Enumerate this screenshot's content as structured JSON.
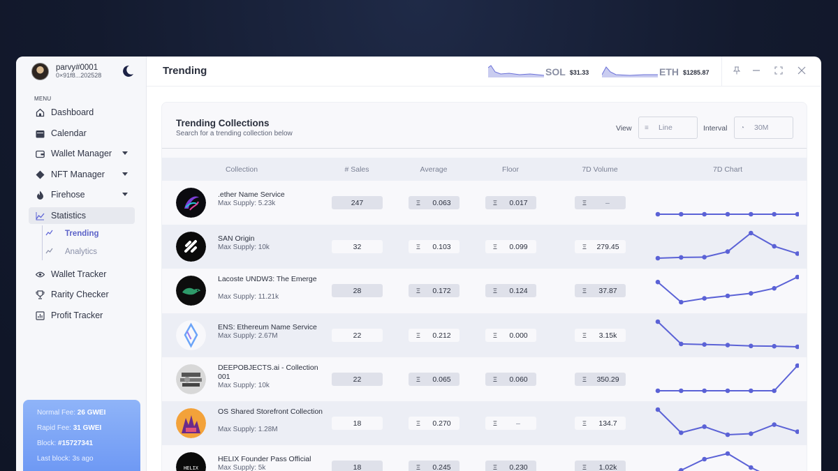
{
  "profile": {
    "name": "parvy#0001",
    "address": "0×91f8...202528"
  },
  "sidebar": {
    "menu_label": "MENU",
    "items": [
      {
        "label": "Dashboard",
        "icon": "home-icon"
      },
      {
        "label": "Calendar",
        "icon": "calendar-icon"
      },
      {
        "label": "Wallet Manager",
        "icon": "wallet-icon"
      },
      {
        "label": "NFT Manager",
        "icon": "diamond-icon"
      },
      {
        "label": "Firehose",
        "icon": "flame-icon"
      },
      {
        "label": "Statistics",
        "icon": "chart-icon"
      },
      {
        "label": "Wallet Tracker",
        "icon": "eye-icon"
      },
      {
        "label": "Rarity Checker",
        "icon": "trophy-icon"
      },
      {
        "label": "Profit Tracker",
        "icon": "report-icon"
      }
    ],
    "sub_items": [
      {
        "label": "Trending"
      },
      {
        "label": "Analytics"
      }
    ]
  },
  "fees": {
    "normal_label": "Normal Fee:",
    "normal_value": "26 GWEI",
    "rapid_label": "Rapid Fee:",
    "rapid_value": "31 GWEI",
    "block_label": "Block:",
    "block_value": "#15727341",
    "last_block": "Last block: 3s ago"
  },
  "header": {
    "title": "Trending",
    "tickers": [
      {
        "symbol": "SOL",
        "price": "$31.33"
      },
      {
        "symbol": "ETH",
        "price": "$1285.87"
      }
    ]
  },
  "panel": {
    "title": "Trending Collections",
    "subtitle": "Search for a trending collection below",
    "view_label": "View",
    "view_value": "Line",
    "interval_label": "Interval",
    "interval_value": "30M"
  },
  "table": {
    "columns": [
      "Collection",
      "# Sales",
      "Average",
      "Floor",
      "7D Volume",
      "7D Chart"
    ],
    "rows": [
      {
        "name": ".ether Name Service",
        "supply": "Max Supply: 5.23k",
        "sales": "247",
        "average": "0.063",
        "floor": "0.017",
        "volume": "–",
        "chart": [
          1,
          1,
          1,
          1,
          1,
          1,
          1
        ]
      },
      {
        "name": "SAN Origin",
        "supply": "Max Supply: 10k",
        "sales": "32",
        "average": "0.103",
        "floor": "0.099",
        "volume": "279.45",
        "chart": [
          0.6,
          0.9,
          1.0,
          3.2,
          10.5,
          5.3,
          2.4
        ]
      },
      {
        "name": "Lacoste UNDW3: The Emerge",
        "supply": "Max Supply: 11.21k",
        "sales": "28",
        "average": "0.172",
        "floor": "0.124",
        "volume": "37.87",
        "chart": [
          9.5,
          1.5,
          3.0,
          4.0,
          5.0,
          7.0,
          11.5
        ]
      },
      {
        "name": "ENS: Ethereum Name Service",
        "supply": "Max Supply: 2.67M",
        "sales": "22",
        "average": "0.212",
        "floor": "0.000",
        "volume": "3.15k",
        "chart": [
          1200,
          420,
          400,
          380,
          350,
          340,
          320
        ]
      },
      {
        "name": "DEEPOBJECTS.ai - Collection 001",
        "supply": "Max Supply: 10k",
        "sales": "22",
        "average": "0.065",
        "floor": "0.060",
        "volume": "350.29",
        "chart": [
          0,
          0,
          0,
          0,
          0,
          0,
          350
        ]
      },
      {
        "name": "OS Shared Storefront Collection",
        "supply": "Max Supply: 1.28M",
        "sales": "18",
        "average": "0.270",
        "floor": "–",
        "volume": "134.7",
        "chart": [
          35,
          12,
          18,
          10,
          11,
          20,
          13
        ]
      },
      {
        "name": "HELIX Founder Pass Official",
        "supply": "Max Supply: 5k",
        "sales": "18",
        "average": "0.245",
        "floor": "0.230",
        "volume": "1.02k",
        "chart": [
          0,
          3,
          7,
          9,
          4,
          0,
          0
        ]
      }
    ]
  },
  "colors": {
    "accent": "#5b62d6",
    "fee_card": "#7aa2f6"
  }
}
